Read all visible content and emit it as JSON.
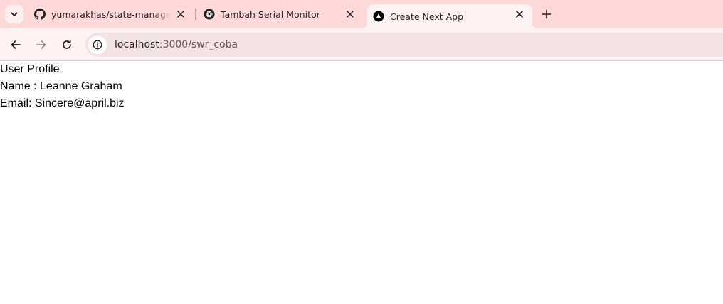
{
  "browser": {
    "tabs": [
      {
        "title": "yumarakhas/state-management",
        "favicon": "github-icon",
        "active": false
      },
      {
        "title": "Tambah Serial Monitor",
        "favicon": "openai-icon",
        "active": false
      },
      {
        "title": "Create Next App",
        "favicon": "nextjs-icon",
        "active": true
      }
    ],
    "address": {
      "host": "localhost",
      "path": ":3000/swr_coba"
    },
    "colors": {
      "tabstrip": "#ffd9d9",
      "toolbar": "#fff2f2",
      "omnibox": "#f3e3e4"
    }
  },
  "content": {
    "heading": "User Profile",
    "name_line": "Name : Leanne Graham",
    "email_line": "Email: Sincere@april.biz"
  }
}
